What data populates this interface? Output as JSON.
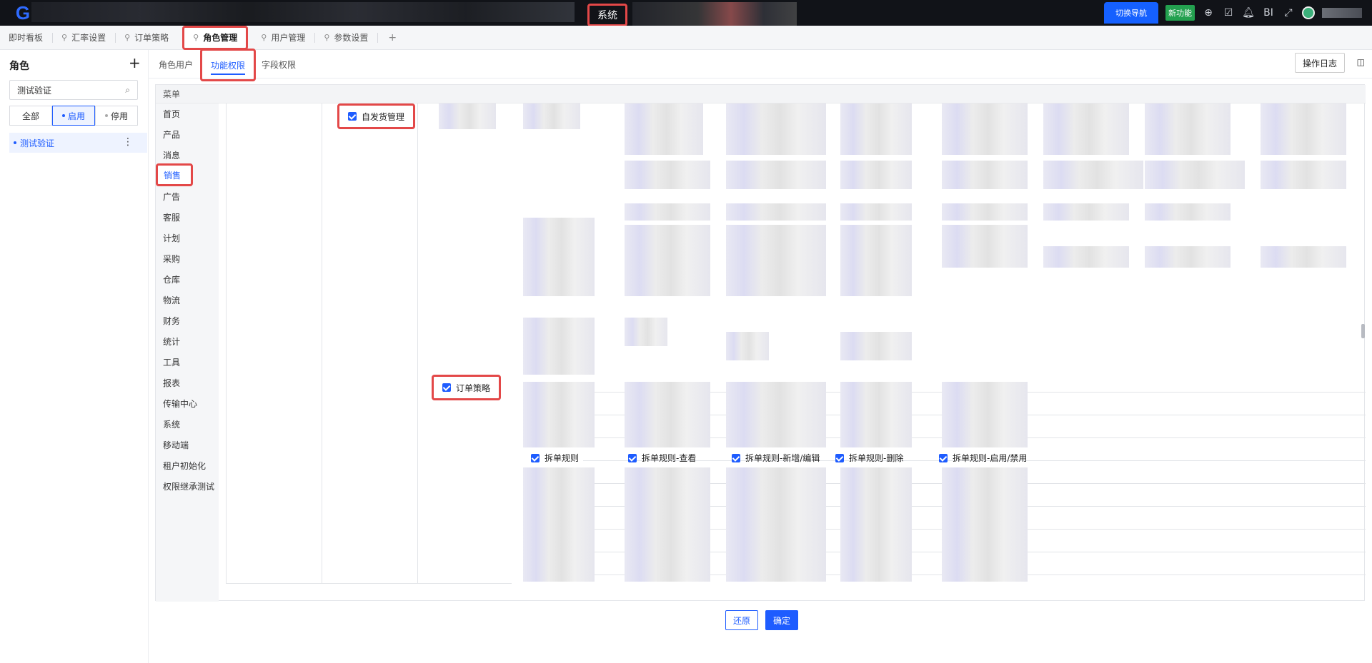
{
  "topbar": {
    "system_title": "系统",
    "switch_nav": "切换导航",
    "new_feature": "新功能",
    "bi": "BI"
  },
  "tabs": [
    {
      "label": "即时看板"
    },
    {
      "label": "汇率设置"
    },
    {
      "label": "订单策略"
    },
    {
      "label": "角色管理"
    },
    {
      "label": "用户管理"
    },
    {
      "label": "参数设置"
    }
  ],
  "sidebar": {
    "title": "角色",
    "search_value": "测试验证",
    "filters": [
      "全部",
      "启用",
      "停用"
    ],
    "role_item": "测试验证"
  },
  "subtabs": [
    "角色用户",
    "功能权限",
    "字段权限"
  ],
  "log_button": "操作日志",
  "menu_header": "菜单",
  "menu_items": [
    "首页",
    "产品",
    "消息",
    "销售",
    "广告",
    "客服",
    "计划",
    "采购",
    "仓库",
    "物流",
    "财务",
    "统计",
    "工具",
    "报表",
    "传输中心",
    "系统",
    "移动端",
    "租户初始化",
    "权限继承测试"
  ],
  "permissions": {
    "self_ship": "自发货管理",
    "order_strategy": "订单策略",
    "split_rule": "拆单规则",
    "split_view": "拆单规则-查看",
    "split_add_edit": "拆单规则-新增/编辑",
    "split_delete": "拆单规则-删除",
    "split_toggle": "拆单规则-启用/禁用"
  },
  "footer": {
    "reset": "还原",
    "confirm": "确定"
  }
}
